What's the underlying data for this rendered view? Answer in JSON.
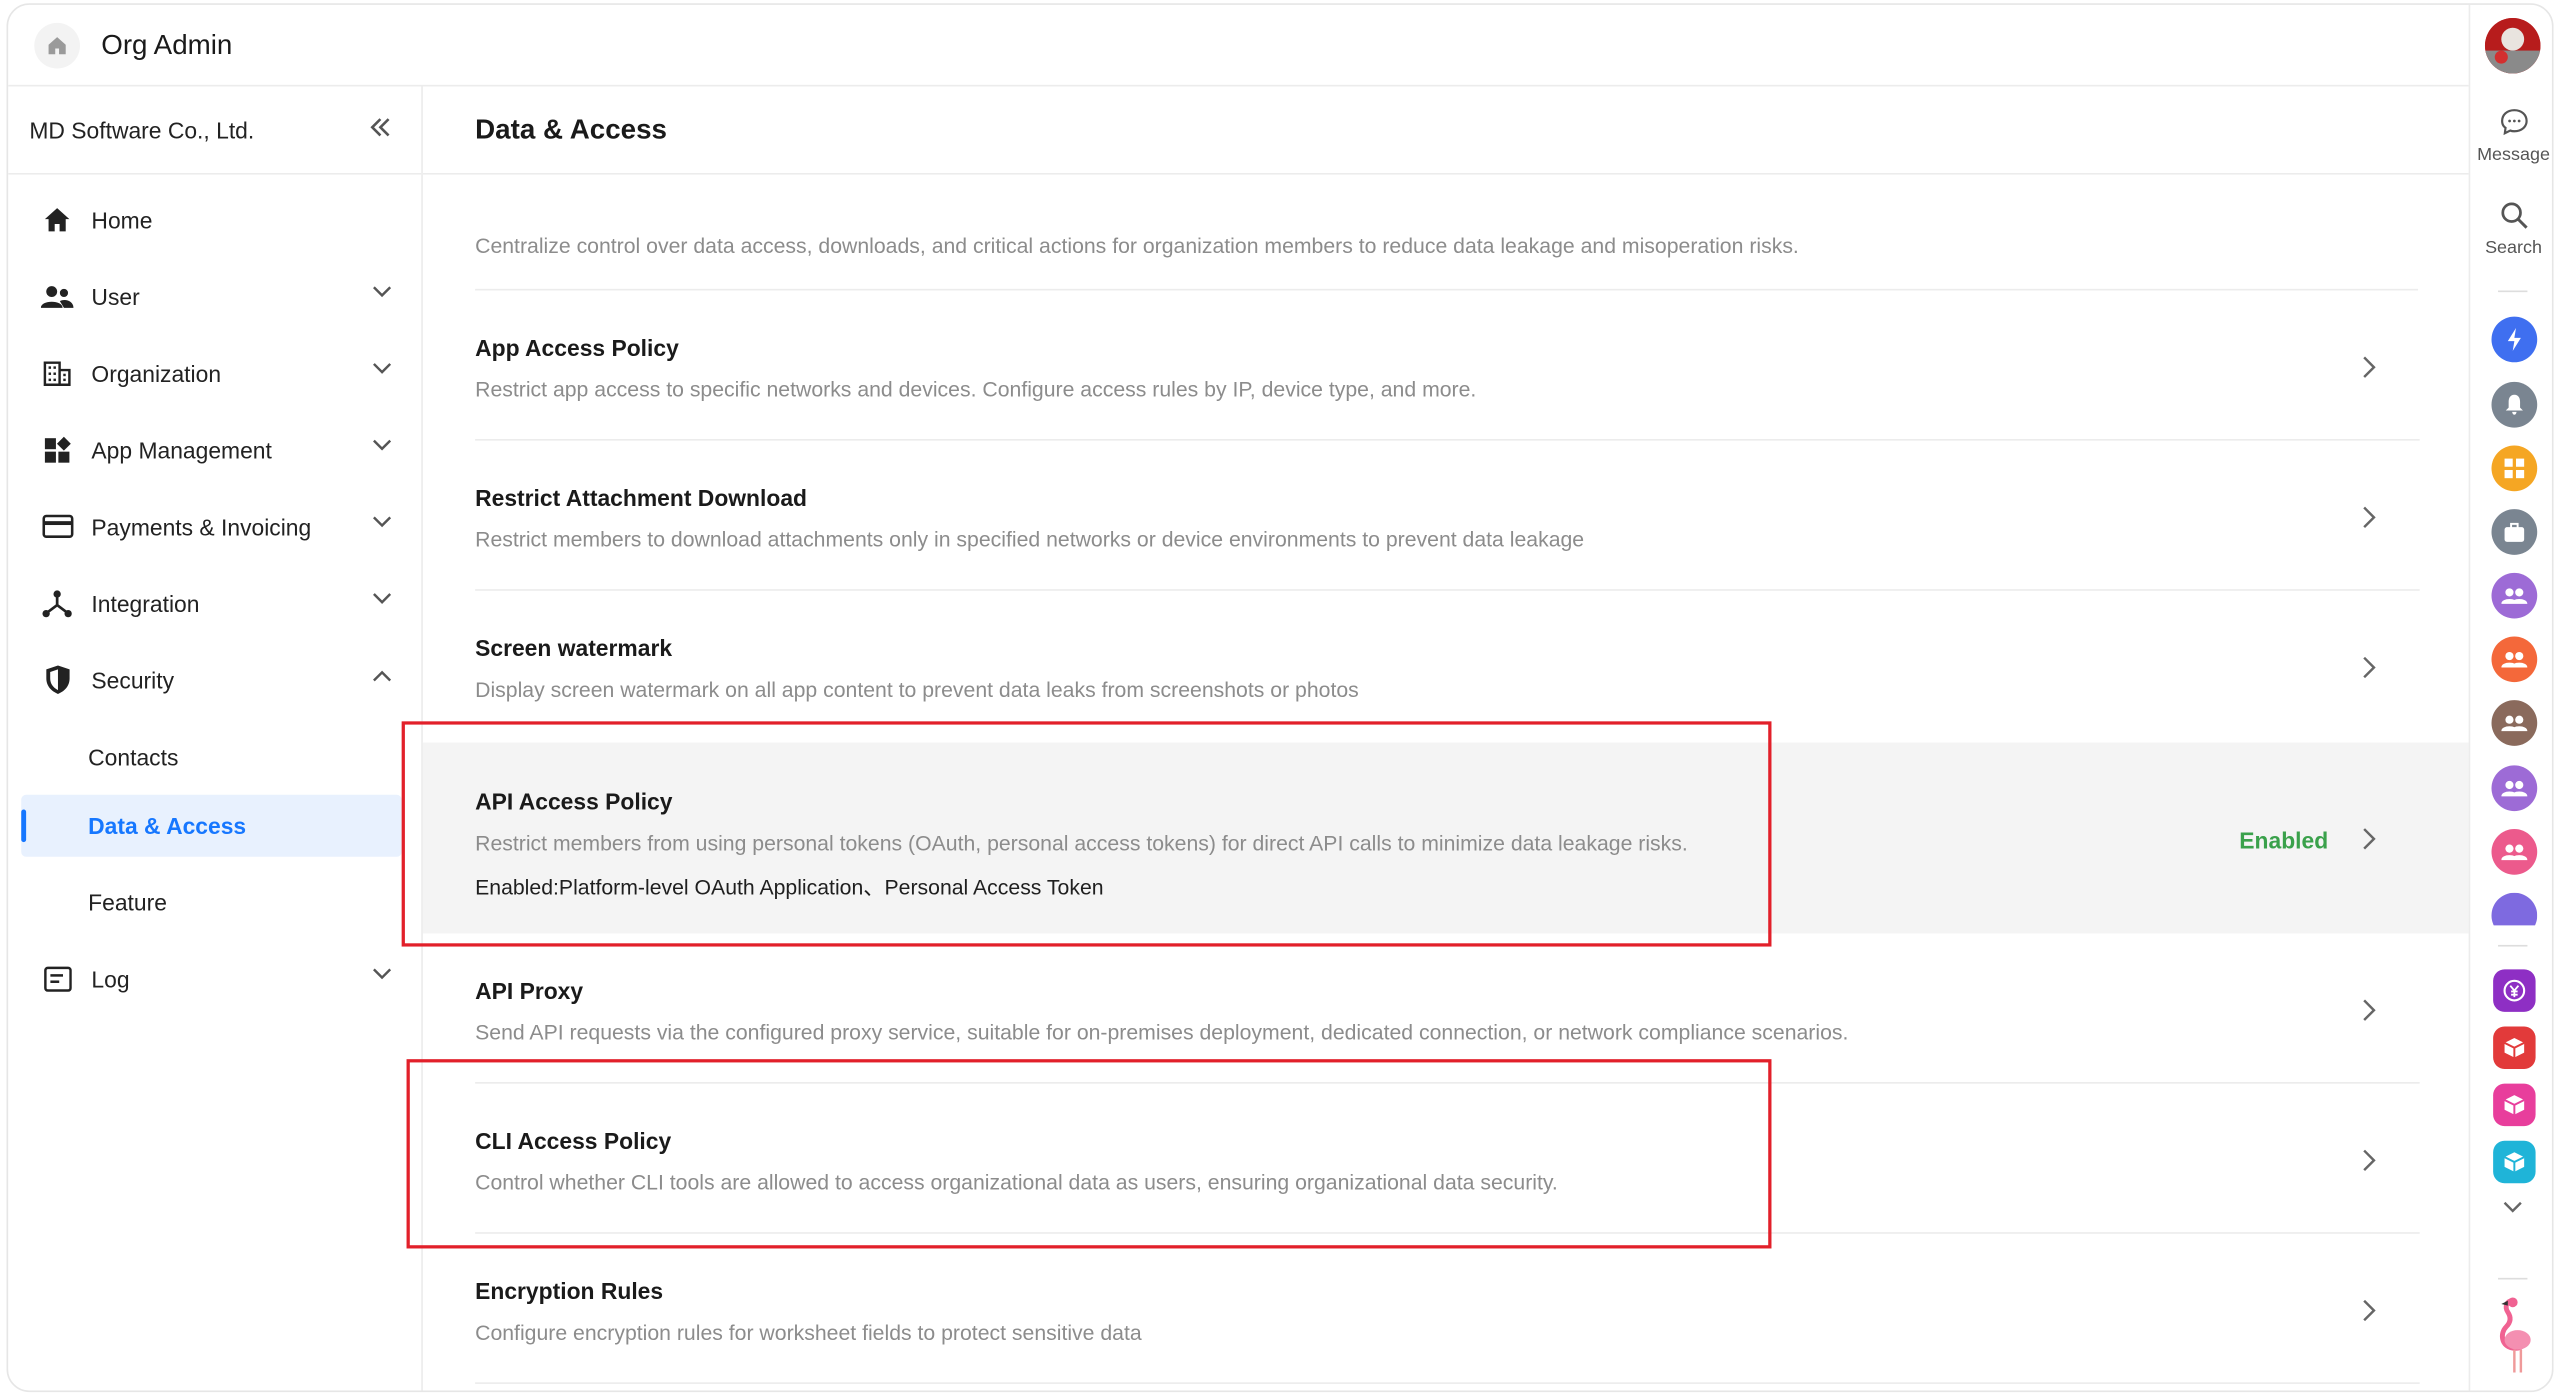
{
  "topbar": {
    "title": "Org Admin"
  },
  "sidebar": {
    "org_name": "MD Software Co., Ltd.",
    "items": [
      {
        "label": "Home",
        "icon": "home-icon"
      },
      {
        "label": "User",
        "icon": "users-icon"
      },
      {
        "label": "Organization",
        "icon": "building-icon"
      },
      {
        "label": "App Management",
        "icon": "apps-icon"
      },
      {
        "label": "Payments & Invoicing",
        "icon": "credit-card-icon"
      },
      {
        "label": "Integration",
        "icon": "integration-icon"
      },
      {
        "label": "Security",
        "icon": "shield-icon"
      },
      {
        "label": "Contacts"
      },
      {
        "label": "Data & Access"
      },
      {
        "label": "Feature"
      },
      {
        "label": "Log",
        "icon": "log-icon"
      }
    ]
  },
  "main": {
    "title": "Data & Access",
    "intro": "Centralize control over data access, downloads, and critical actions for organization members to reduce data leakage and misoperation risks.",
    "policies": [
      {
        "title": "App Access Policy",
        "desc": "Restrict app access to specific networks and devices. Configure access rules by IP, device type, and more."
      },
      {
        "title": "Restrict Attachment Download",
        "desc": "Restrict members to download attachments only in specified networks or device environments to prevent data leakage"
      },
      {
        "title": "Screen watermark",
        "desc": "Display screen watermark on all app content to prevent data leaks from screenshots or photos"
      },
      {
        "title": "API Access Policy",
        "desc": "Restrict members from using personal tokens (OAuth, personal access tokens) for direct API calls to minimize data leakage risks.",
        "extra": "Enabled:Platform-level OAuth Application、Personal Access Token",
        "status": "Enabled"
      },
      {
        "title": "API Proxy",
        "desc": "Send API requests via the configured proxy service, suitable for on-premises deployment, dedicated connection, or network compliance scenarios."
      },
      {
        "title": "CLI Access Policy",
        "desc": "Control whether CLI tools are allowed to access organizational data as users, ensuring organizational data security."
      },
      {
        "title": "Encryption Rules",
        "desc": "Configure encryption rules for worksheet fields to protect sensitive data"
      }
    ]
  },
  "rail": {
    "message_label": "Message",
    "search_label": "Search"
  },
  "colors": {
    "accent": "#1677ff",
    "enabled": "#3aa14b",
    "highlight_box": "#e2202a"
  }
}
